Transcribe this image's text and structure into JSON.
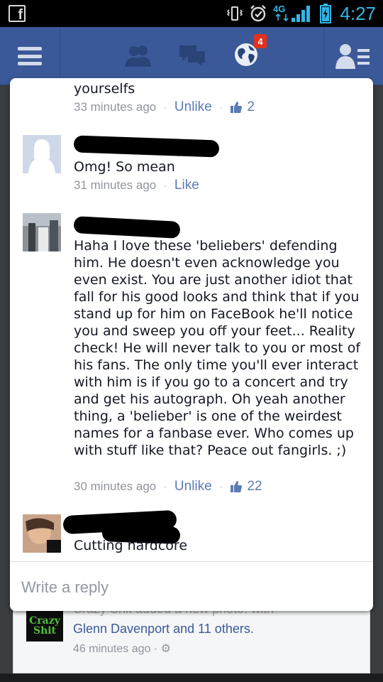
{
  "status_bar": {
    "left_icon": "facebook-notification-icon",
    "network": "4G",
    "time": "4:27",
    "icons": [
      "vibrate-icon",
      "alarm-icon",
      "4g-signal-icon",
      "battery-icon"
    ]
  },
  "nav": {
    "notifications_count": "4",
    "icons": [
      "menu-icon",
      "friend-requests-icon",
      "messages-icon",
      "notifications-globe-icon",
      "friends-list-icon"
    ],
    "color": "#3b5998"
  },
  "comments": [
    {
      "text": "yourselfs",
      "time": "33 minutes ago",
      "action": "Unlike",
      "likes": "2"
    },
    {
      "text": "Omg! So mean",
      "time": "31 minutes ago",
      "action": "Like"
    },
    {
      "text": "Haha I love these 'beliebers' defending him. He doesn't even acknowledge you even exist. You are just another idiot that fall for his good looks and think that if you stand up for him on FaceBook he'll notice you and sweep you off your feet... Reality check! He will never talk to you or most of his fans. The only time you'll ever interact with him is if you go to a concert and try and get his autograph. Oh yeah another thing, a 'belieber' is one of the weirdest names for a fanbase ever. Who comes up with stuff like that? Peace out fangirls. ;)",
      "time": "30 minutes ago",
      "action": "Unlike",
      "likes": "22"
    },
    {
      "text": "Cutting hardcore"
    }
  ],
  "reply": {
    "placeholder": "Write a reply"
  },
  "background_story": {
    "line1": "Crazy Shit added a new photo.",
    "line1_suffix": "with",
    "line2": "Glenn Davenport and 11 others.",
    "time": "46 minutes ago",
    "avatar_text": "Crazy Shit"
  },
  "colors": {
    "link": "#5b7bb4",
    "meta": "#90949c",
    "status": "#33b5e5",
    "badge": "#e0311f"
  }
}
